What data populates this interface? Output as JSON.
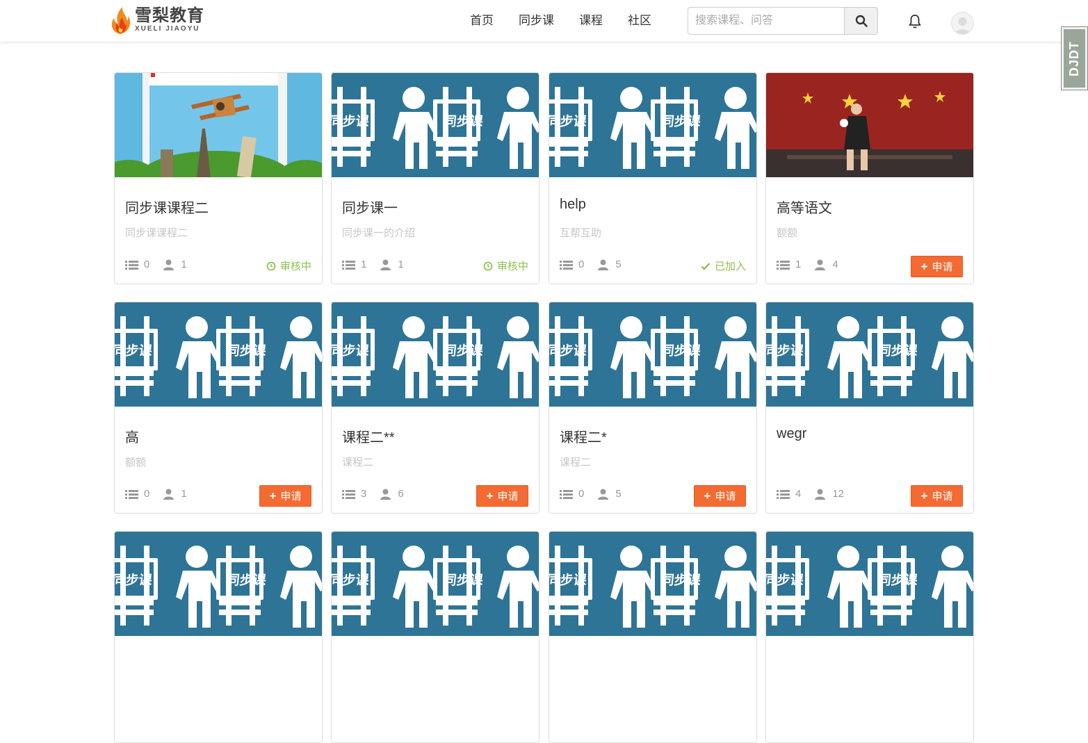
{
  "brand": {
    "name_cn": "雪梨教育",
    "name_en": "XUELI JIAOYU"
  },
  "nav": [
    {
      "label": "首页"
    },
    {
      "label": "同步课"
    },
    {
      "label": "课程"
    },
    {
      "label": "社区"
    }
  ],
  "search": {
    "placeholder": "搜索课程、问答",
    "value": ""
  },
  "side_tab": {
    "label": "DJDT"
  },
  "colors": {
    "accent": "#f36b32",
    "status_green": "#8cc24f",
    "cover_blue": "#2e7496"
  },
  "courses": [
    {
      "title": "同步课课程二",
      "subtitle": "同步课课程二",
      "lessons": "0",
      "students": "1",
      "status": "审核中",
      "status_icon": "clock-icon",
      "action": null,
      "cover": "airplane-landmarks-image"
    },
    {
      "title": "同步课一",
      "subtitle": "同步课一的介绍",
      "lessons": "1",
      "students": "1",
      "status": "审核中",
      "status_icon": "clock-icon",
      "action": null,
      "cover": "sync-class-pattern"
    },
    {
      "title": "help",
      "subtitle": "互帮互助",
      "lessons": "0",
      "students": "5",
      "status": "已加入",
      "status_icon": "check-icon",
      "action": null,
      "cover": "sync-class-pattern"
    },
    {
      "title": "高等语文",
      "subtitle": "额额",
      "lessons": "1",
      "students": "4",
      "status": null,
      "action": "申请",
      "cover": "pingpong-player-image"
    },
    {
      "title": "高",
      "subtitle": "额额",
      "lessons": "0",
      "students": "1",
      "status": null,
      "action": "申请",
      "cover": "sync-class-pattern"
    },
    {
      "title": "课程二**",
      "subtitle": "课程二",
      "lessons": "3",
      "students": "6",
      "status": null,
      "action": "申请",
      "cover": "sync-class-pattern"
    },
    {
      "title": "课程二*",
      "subtitle": "课程二",
      "lessons": "0",
      "students": "5",
      "status": null,
      "action": "申请",
      "cover": "sync-class-pattern"
    },
    {
      "title": "wegr",
      "subtitle": "",
      "lessons": "4",
      "students": "12",
      "status": null,
      "action": "申请",
      "cover": "sync-class-pattern"
    },
    {
      "title": "",
      "subtitle": "",
      "lessons": "",
      "students": "",
      "status": null,
      "action": null,
      "cover": "sync-class-pattern"
    },
    {
      "title": "",
      "subtitle": "",
      "lessons": "",
      "students": "",
      "status": null,
      "action": null,
      "cover": "sync-class-pattern"
    },
    {
      "title": "",
      "subtitle": "",
      "lessons": "",
      "students": "",
      "status": null,
      "action": null,
      "cover": "sync-class-pattern"
    },
    {
      "title": "",
      "subtitle": "",
      "lessons": "",
      "students": "",
      "status": null,
      "action": null,
      "cover": "sync-class-pattern"
    }
  ]
}
